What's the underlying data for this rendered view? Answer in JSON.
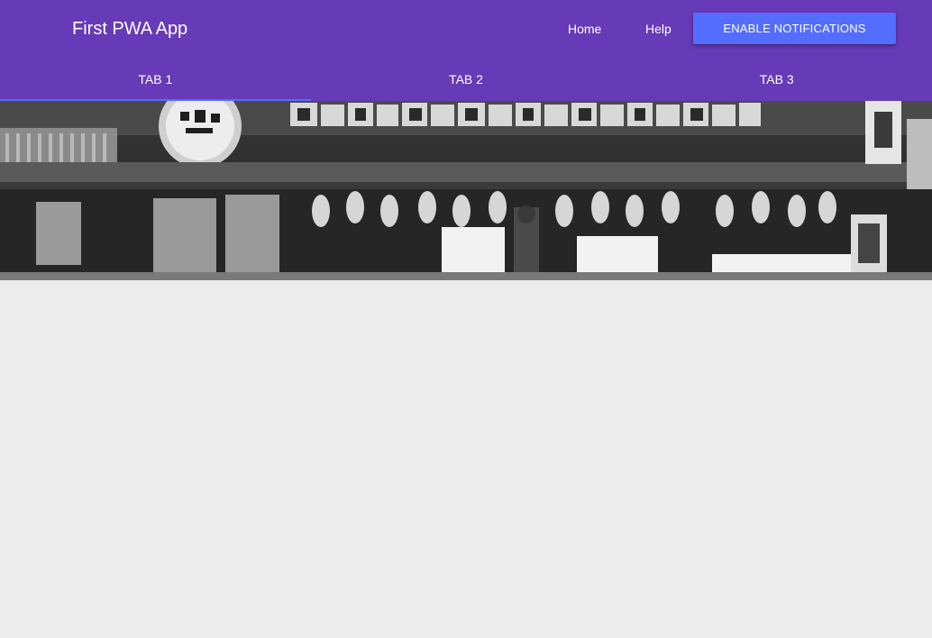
{
  "header": {
    "title": "First PWA App",
    "nav": {
      "home_label": "Home",
      "help_label": "Help"
    },
    "notify_button_label": "ENABLE NOTIFICATIONS"
  },
  "tabs": [
    {
      "label": "TAB 1",
      "active": true
    },
    {
      "label": "TAB 2",
      "active": false
    },
    {
      "label": "TAB 3",
      "active": false
    }
  ],
  "colors": {
    "primary": "#673ab7",
    "accent": "#536dfe",
    "background": "#ececec"
  }
}
